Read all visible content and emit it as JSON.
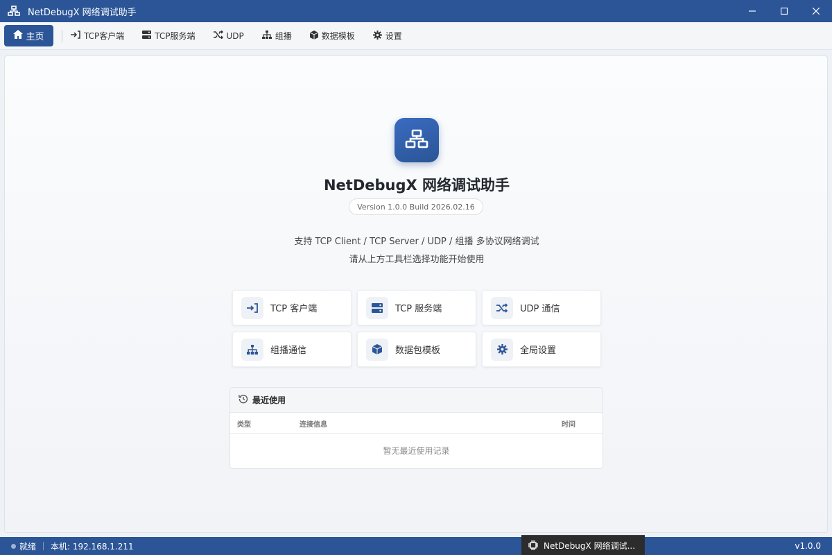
{
  "window": {
    "title": "NetDebugX 网络调试助手",
    "app_icon": "network-icon",
    "controls": [
      "minimize-icon",
      "maximize-icon",
      "close-icon"
    ]
  },
  "toolbar": {
    "home_label": "主页",
    "items": [
      {
        "label": "TCP客户端",
        "icon": "sign-in-icon"
      },
      {
        "label": "TCP服务端",
        "icon": "server-icon"
      },
      {
        "label": "UDP",
        "icon": "shuffle-icon"
      },
      {
        "label": "组播",
        "icon": "sitemap-icon"
      },
      {
        "label": "数据模板",
        "icon": "cube-icon"
      },
      {
        "label": "设置",
        "icon": "gear-icon"
      }
    ]
  },
  "hero": {
    "app_name": "NetDebugX 网络调试助手",
    "version": "Version 1.0.0 Build 2026.02.16",
    "desc_line1": "支持 TCP Client / TCP Server / UDP / 组播 多协议网络调试",
    "desc_line2": "请从上方工具栏选择功能开始使用"
  },
  "cards": [
    {
      "label": "TCP 客户端",
      "icon": "sign-in-icon"
    },
    {
      "label": "TCP 服务端",
      "icon": "server-icon"
    },
    {
      "label": "UDP 通信",
      "icon": "shuffle-icon"
    },
    {
      "label": "组播通信",
      "icon": "sitemap-icon"
    },
    {
      "label": "数据包模板",
      "icon": "cube-icon"
    },
    {
      "label": "全局设置",
      "icon": "gear-icon"
    }
  ],
  "recent": {
    "title": "最近使用",
    "columns": {
      "type": "类型",
      "info": "连接信息",
      "time": "时间"
    },
    "empty_text": "暂无最近使用记录"
  },
  "statusbar": {
    "status": "就绪",
    "local_ip": "本机: 192.168.1.211",
    "version": "v1.0.0"
  },
  "taskbar_popup": {
    "label": "NetDebugX 网络调试..."
  },
  "colors": {
    "primary": "#2b5597",
    "background": "#eef1f5"
  }
}
